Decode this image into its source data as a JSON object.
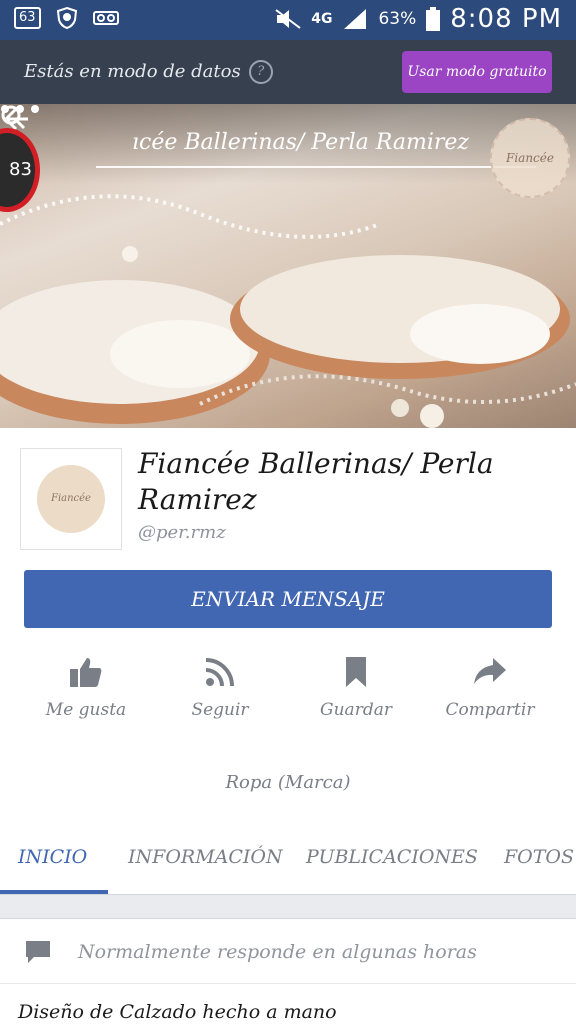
{
  "status_bar": {
    "notification_count": "63",
    "network": "4G",
    "battery": "63%",
    "time": "8:08 PM"
  },
  "data_banner": {
    "text": "Estás en modo de datos",
    "help": "?",
    "button": "Usar modo gratuito"
  },
  "header": {
    "search_text": "ıcée Ballerinas/ Perla Ramirez",
    "badge_count": "83",
    "logo_text": "Fiancée"
  },
  "profile": {
    "avatar_text": "Fiancée",
    "name": "Fiancée Ballerinas/ Perla Ramirez",
    "handle": "@per.rmz",
    "message_button": "ENVIAR MENSAJE",
    "actions": [
      {
        "label": "Me gusta",
        "icon": "thumbs-up-icon"
      },
      {
        "label": "Seguir",
        "icon": "rss-icon"
      },
      {
        "label": "Guardar",
        "icon": "bookmark-icon"
      },
      {
        "label": "Compartir",
        "icon": "share-icon"
      }
    ],
    "category": "Ropa (Marca)"
  },
  "tabs": [
    {
      "label": "INICIO",
      "active": true
    },
    {
      "label": "INFORMACIÓN",
      "active": false
    },
    {
      "label": "PUBLICACIONES",
      "active": false
    },
    {
      "label": "FOTOS",
      "active": false
    }
  ],
  "info_card": {
    "response_text": "Normalmente responde en algunas horas",
    "about": "Diseño de Calzado hecho a mano"
  },
  "colors": {
    "status_bar": "#2c4a7c",
    "data_banner": "#36404f",
    "free_button": "#9b45c4",
    "facebook_blue": "#4267b2"
  }
}
